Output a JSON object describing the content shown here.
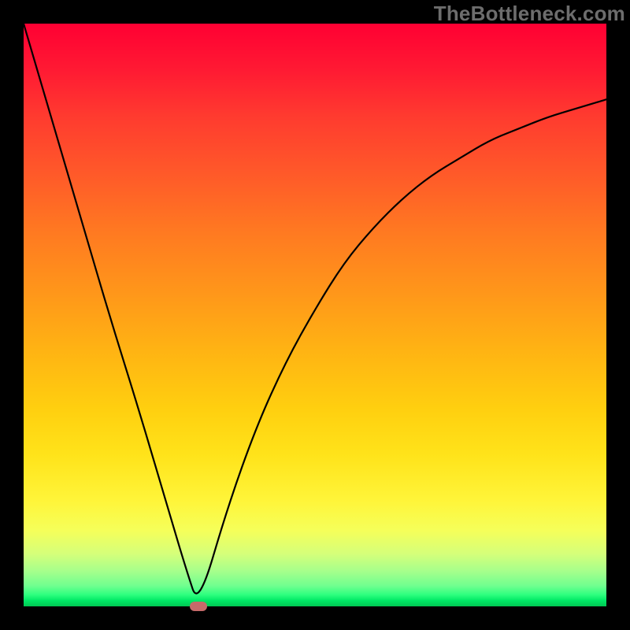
{
  "watermark": "TheBottleneck.com",
  "chart_data": {
    "type": "line",
    "title": "",
    "xlabel": "",
    "ylabel": "",
    "xlim": [
      0,
      100
    ],
    "ylim": [
      0,
      100
    ],
    "grid": false,
    "legend": false,
    "series": [
      {
        "name": "curve",
        "x": [
          0,
          5,
          10,
          15,
          20,
          25,
          28,
          30,
          35,
          40,
          45,
          50,
          55,
          60,
          65,
          70,
          75,
          80,
          85,
          90,
          95,
          100
        ],
        "y": [
          100,
          83,
          66,
          49,
          33,
          16,
          6,
          0,
          17,
          31,
          42,
          51,
          59,
          65,
          70,
          74,
          77,
          80,
          82,
          84,
          85.5,
          87
        ]
      }
    ],
    "marker": {
      "x": 30,
      "y": 0,
      "color": "#c76a6a"
    },
    "gradient_stops": [
      {
        "pos": 0,
        "color": "#ff0033"
      },
      {
        "pos": 0.5,
        "color": "#ffb313"
      },
      {
        "pos": 0.85,
        "color": "#fff53a"
      },
      {
        "pos": 1.0,
        "color": "#00c853"
      }
    ]
  }
}
